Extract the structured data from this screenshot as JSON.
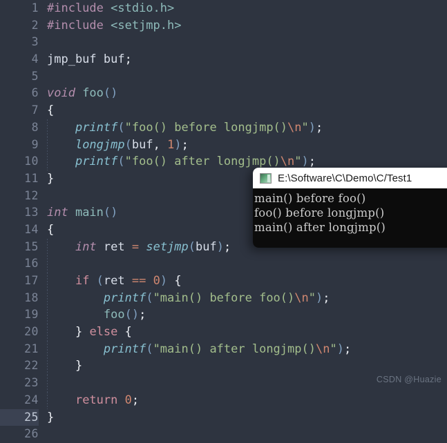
{
  "editor": {
    "background": "#2e3440",
    "current_line": 25,
    "lines": [
      {
        "num": "1",
        "tokens": [
          {
            "t": "#include ",
            "c": "t-pre"
          },
          {
            "t": "<stdio.h>",
            "c": "t-inc"
          }
        ],
        "indent_guide": false
      },
      {
        "num": "2",
        "tokens": [
          {
            "t": "#include ",
            "c": "t-pre"
          },
          {
            "t": "<setjmp.h>",
            "c": "t-inc"
          }
        ],
        "indent_guide": false
      },
      {
        "num": "3",
        "tokens": [],
        "indent_guide": false
      },
      {
        "num": "4",
        "tokens": [
          {
            "t": "jmp_buf buf",
            "c": "t-id"
          },
          {
            "t": ";",
            "c": "t-punct"
          }
        ],
        "indent_guide": false
      },
      {
        "num": "5",
        "tokens": [],
        "indent_guide": false
      },
      {
        "num": "6",
        "tokens": [
          {
            "t": "void ",
            "c": "t-kw"
          },
          {
            "t": "foo",
            "c": "t-fnd"
          },
          {
            "t": "()",
            "c": "t-paren"
          }
        ],
        "indent_guide": false
      },
      {
        "num": "7",
        "tokens": [
          {
            "t": "{",
            "c": "t-punct"
          }
        ],
        "indent_guide": false
      },
      {
        "num": "8",
        "tokens": [
          {
            "t": "    ",
            "c": "t-id"
          },
          {
            "t": "printf",
            "c": "t-fn"
          },
          {
            "t": "(",
            "c": "t-paren"
          },
          {
            "t": "\"foo() before longjmp()",
            "c": "t-str"
          },
          {
            "t": "\\n",
            "c": "t-esc"
          },
          {
            "t": "\"",
            "c": "t-str"
          },
          {
            "t": ")",
            "c": "t-paren"
          },
          {
            "t": ";",
            "c": "t-punct"
          }
        ],
        "indent_guide": true
      },
      {
        "num": "9",
        "tokens": [
          {
            "t": "    ",
            "c": "t-id"
          },
          {
            "t": "longjmp",
            "c": "t-fn"
          },
          {
            "t": "(",
            "c": "t-paren"
          },
          {
            "t": "buf",
            "c": "t-id"
          },
          {
            "t": ", ",
            "c": "t-punct"
          },
          {
            "t": "1",
            "c": "t-num"
          },
          {
            "t": ")",
            "c": "t-paren"
          },
          {
            "t": ";",
            "c": "t-punct"
          }
        ],
        "indent_guide": true
      },
      {
        "num": "10",
        "tokens": [
          {
            "t": "    ",
            "c": "t-id"
          },
          {
            "t": "printf",
            "c": "t-fn"
          },
          {
            "t": "(",
            "c": "t-paren"
          },
          {
            "t": "\"foo() after longjmp()",
            "c": "t-str"
          },
          {
            "t": "\\n",
            "c": "t-esc"
          },
          {
            "t": "\"",
            "c": "t-str"
          },
          {
            "t": ")",
            "c": "t-paren"
          },
          {
            "t": ";",
            "c": "t-punct"
          }
        ],
        "indent_guide": true
      },
      {
        "num": "11",
        "tokens": [
          {
            "t": "}",
            "c": "t-punct"
          }
        ],
        "indent_guide": false
      },
      {
        "num": "12",
        "tokens": [],
        "indent_guide": false
      },
      {
        "num": "13",
        "tokens": [
          {
            "t": "int ",
            "c": "t-kw"
          },
          {
            "t": "main",
            "c": "t-fnd"
          },
          {
            "t": "()",
            "c": "t-paren"
          }
        ],
        "indent_guide": false
      },
      {
        "num": "14",
        "tokens": [
          {
            "t": "{",
            "c": "t-punct"
          }
        ],
        "indent_guide": false
      },
      {
        "num": "15",
        "tokens": [
          {
            "t": "    ",
            "c": "t-id"
          },
          {
            "t": "int ",
            "c": "t-kw"
          },
          {
            "t": "ret ",
            "c": "t-id"
          },
          {
            "t": "= ",
            "c": "t-op"
          },
          {
            "t": "setjmp",
            "c": "t-fn"
          },
          {
            "t": "(",
            "c": "t-paren"
          },
          {
            "t": "buf",
            "c": "t-id"
          },
          {
            "t": ")",
            "c": "t-paren"
          },
          {
            "t": ";",
            "c": "t-punct"
          }
        ],
        "indent_guide": true
      },
      {
        "num": "16",
        "tokens": [],
        "indent_guide": true
      },
      {
        "num": "17",
        "tokens": [
          {
            "t": "    ",
            "c": "t-id"
          },
          {
            "t": "if ",
            "c": "t-kw2"
          },
          {
            "t": "(",
            "c": "t-paren"
          },
          {
            "t": "ret ",
            "c": "t-id"
          },
          {
            "t": "== ",
            "c": "t-op"
          },
          {
            "t": "0",
            "c": "t-num"
          },
          {
            "t": ")",
            "c": "t-paren"
          },
          {
            "t": " ",
            "c": "t-id"
          },
          {
            "t": "{",
            "c": "t-punct"
          }
        ],
        "indent_guide": true
      },
      {
        "num": "18",
        "tokens": [
          {
            "t": "        ",
            "c": "t-id"
          },
          {
            "t": "printf",
            "c": "t-fn"
          },
          {
            "t": "(",
            "c": "t-paren"
          },
          {
            "t": "\"main() before foo()",
            "c": "t-str"
          },
          {
            "t": "\\n",
            "c": "t-esc"
          },
          {
            "t": "\"",
            "c": "t-str"
          },
          {
            "t": ")",
            "c": "t-paren"
          },
          {
            "t": ";",
            "c": "t-punct"
          }
        ],
        "indent_guide": true
      },
      {
        "num": "19",
        "tokens": [
          {
            "t": "        ",
            "c": "t-id"
          },
          {
            "t": "foo",
            "c": "t-fnd"
          },
          {
            "t": "()",
            "c": "t-paren"
          },
          {
            "t": ";",
            "c": "t-punct"
          }
        ],
        "indent_guide": true
      },
      {
        "num": "20",
        "tokens": [
          {
            "t": "    ",
            "c": "t-id"
          },
          {
            "t": "}",
            "c": "t-punct"
          },
          {
            "t": " ",
            "c": "t-id"
          },
          {
            "t": "else",
            "c": "t-kw2"
          },
          {
            "t": " ",
            "c": "t-id"
          },
          {
            "t": "{",
            "c": "t-punct"
          }
        ],
        "indent_guide": true
      },
      {
        "num": "21",
        "tokens": [
          {
            "t": "        ",
            "c": "t-id"
          },
          {
            "t": "printf",
            "c": "t-fn"
          },
          {
            "t": "(",
            "c": "t-paren"
          },
          {
            "t": "\"main() after longjmp()",
            "c": "t-str"
          },
          {
            "t": "\\n",
            "c": "t-esc"
          },
          {
            "t": "\"",
            "c": "t-str"
          },
          {
            "t": ")",
            "c": "t-paren"
          },
          {
            "t": ";",
            "c": "t-punct"
          }
        ],
        "indent_guide": true
      },
      {
        "num": "22",
        "tokens": [
          {
            "t": "    ",
            "c": "t-id"
          },
          {
            "t": "}",
            "c": "t-punct"
          }
        ],
        "indent_guide": true
      },
      {
        "num": "23",
        "tokens": [],
        "indent_guide": true
      },
      {
        "num": "24",
        "tokens": [
          {
            "t": "    ",
            "c": "t-id"
          },
          {
            "t": "return ",
            "c": "t-kw2"
          },
          {
            "t": "0",
            "c": "t-num"
          },
          {
            "t": ";",
            "c": "t-punct"
          }
        ],
        "indent_guide": true
      },
      {
        "num": "25",
        "tokens": [
          {
            "t": "}",
            "c": "t-punct"
          }
        ],
        "indent_guide": false
      },
      {
        "num": "26",
        "tokens": [],
        "indent_guide": false
      }
    ]
  },
  "terminal": {
    "icon": "console-window-icon",
    "title": "E:\\Software\\C\\Demo\\C/Test1",
    "output": [
      "main() before foo()",
      "foo() before longjmp()",
      "main() after longjmp()"
    ]
  },
  "watermark": {
    "text": "CSDN @Huazie"
  }
}
